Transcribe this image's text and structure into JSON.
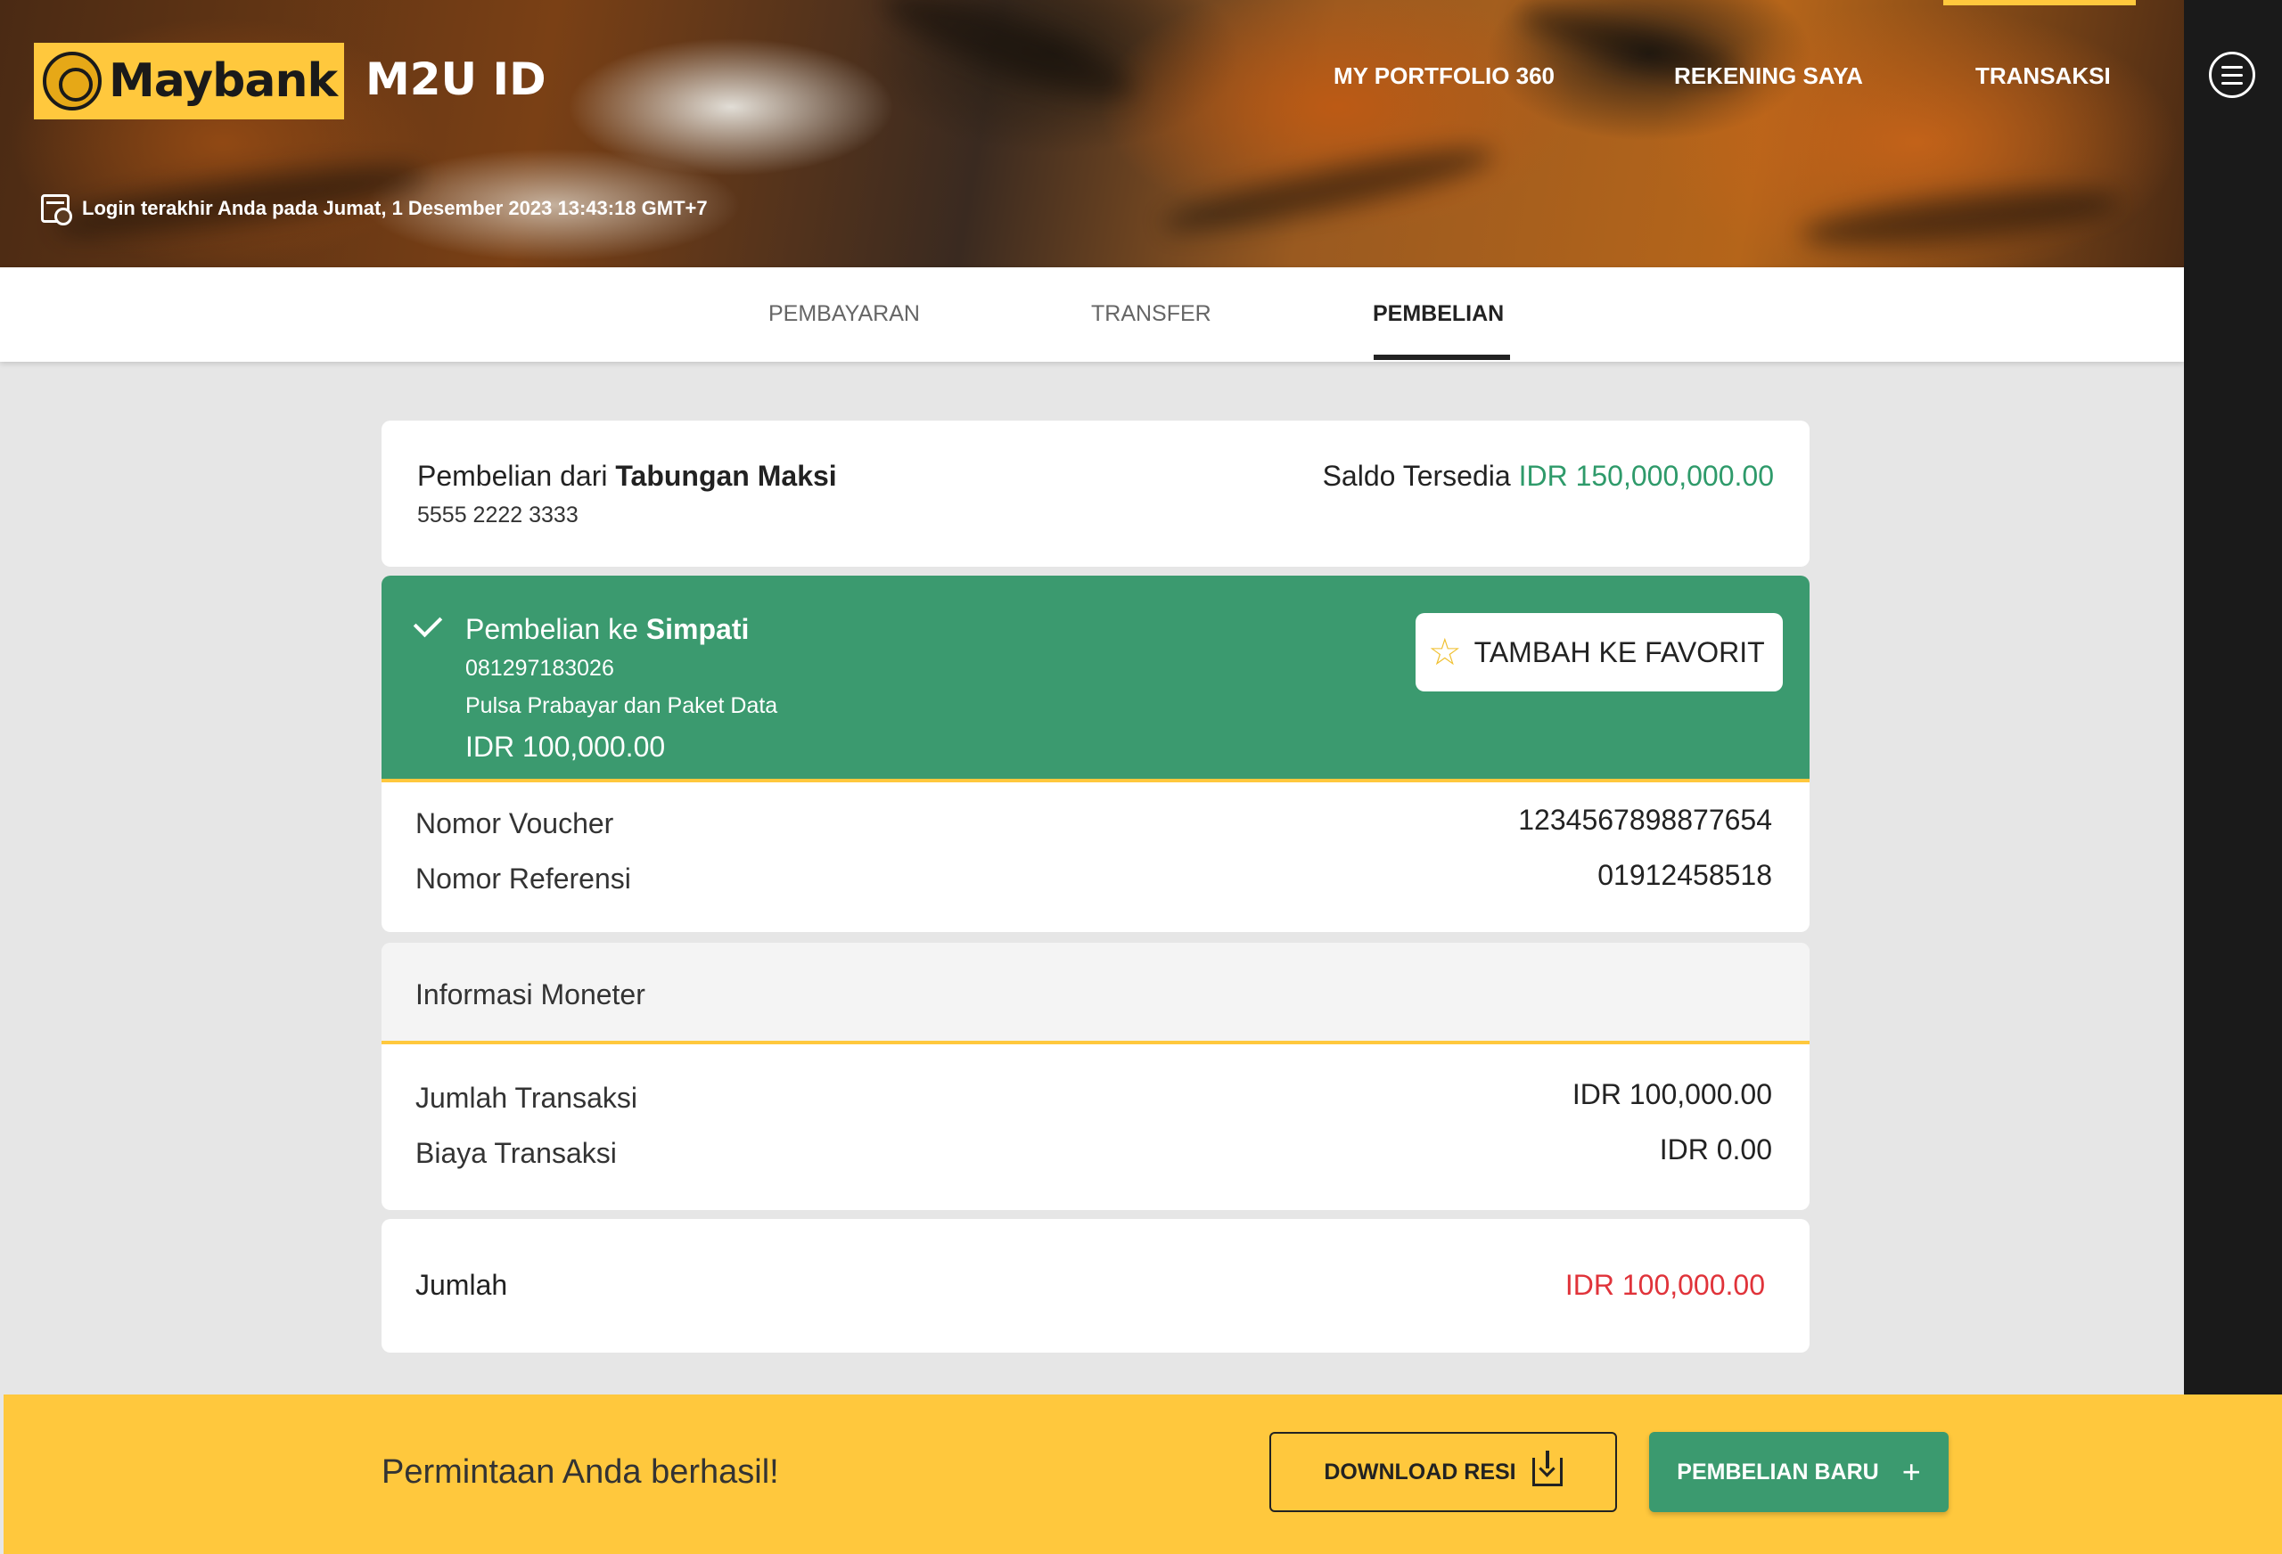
{
  "header": {
    "brand": "Maybank",
    "app_name": "M2U ID",
    "nav": [
      "MY PORTFOLIO 360",
      "REKENING SAYA",
      "TRANSAKSI"
    ],
    "login_info": "Login terakhir Anda pada Jumat, 1 Desember 2023 13:43:18 GMT+7"
  },
  "tabs": [
    {
      "label": "PEMBAYARAN",
      "active": false
    },
    {
      "label": "TRANSFER",
      "active": false
    },
    {
      "label": "PEMBELIAN",
      "active": true
    }
  ],
  "source": {
    "prefix": "Pembelian dari",
    "account_name": "Tabungan Maksi",
    "account_number": "5555 2222 3333",
    "balance_label": "Saldo Tersedia",
    "balance_value": "IDR 150,000,000.00"
  },
  "result": {
    "prefix": "Pembelian ke",
    "provider": "Simpati",
    "phone": "081297183026",
    "product": "Pulsa Prabayar dan Paket Data",
    "amount": "IDR 100,000.00",
    "favorite_label": "TAMBAH KE FAVORIT"
  },
  "details": [
    {
      "label": "Nomor Voucher",
      "value": "1234567898877654"
    },
    {
      "label": "Nomor Referensi",
      "value": "01912458518"
    }
  ],
  "monetary": {
    "title": "Informasi Moneter",
    "rows": [
      {
        "label": "Jumlah Transaksi",
        "value": "IDR 100,000.00"
      },
      {
        "label": "Biaya Transaksi",
        "value": "IDR 0.00"
      }
    ]
  },
  "total": {
    "label": "Jumlah",
    "value": "IDR 100,000.00"
  },
  "footer": {
    "message": "Permintaan Anda berhasil!",
    "download_label": "DOWNLOAD RESI",
    "new_purchase_label": "PEMBELIAN BARU"
  },
  "colors": {
    "brand_yellow": "#ffc83d",
    "success_green": "#3b9a6f",
    "total_red": "#e0333a"
  }
}
